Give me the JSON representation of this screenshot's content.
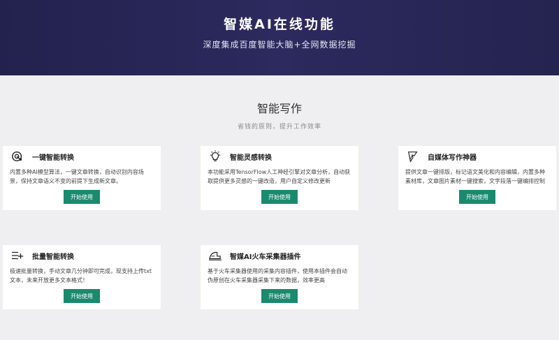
{
  "hero": {
    "title": "智媒AI在线功能",
    "subtitle": "深度集成百度智能大脑+全网数据挖掘"
  },
  "section": {
    "title": "智能写作",
    "subtitle": "省钱的原则，提升工作效率"
  },
  "accent_color": "#1a8a6e",
  "cards": [
    {
      "icon": "target-icon",
      "name": "一键智能转换",
      "desc": "内置多种AI模型算法，一键文章转换，自动识别内容场景，保持文章语义不变的前提下生成新文章。",
      "button": "开始使用"
    },
    {
      "icon": "lightbulb-icon",
      "name": "智能灵感转换",
      "desc": "本功能采用TensorFlow人工神经引擎对文章分析，自动获取提供更多灵感的一键改造，用户自定义修改更新",
      "button": "开始使用"
    },
    {
      "icon": "quill-icon",
      "name": "自媒体写作神器",
      "desc": "提供文章一键排版，标记语文美化和内容编辑，内置多种素材库，文章图片素材一键搜索，文字段落一键编排控制",
      "button": "开始使用"
    },
    {
      "icon": "list-plus-icon",
      "name": "批量智能转换",
      "desc": "极速批量转换，手动文章几分钟即可完成，现支持上传txt文本，未来开放更多文本格式！",
      "button": "开始使用"
    },
    {
      "icon": "train-icon",
      "name": "智媒AI火车采集器插件",
      "desc": "基于火车采集器使用的采集内容插件，使用本插件会自动伪原创在火车采集器采集下来的数据，效率更高",
      "button": "开始使用"
    }
  ]
}
